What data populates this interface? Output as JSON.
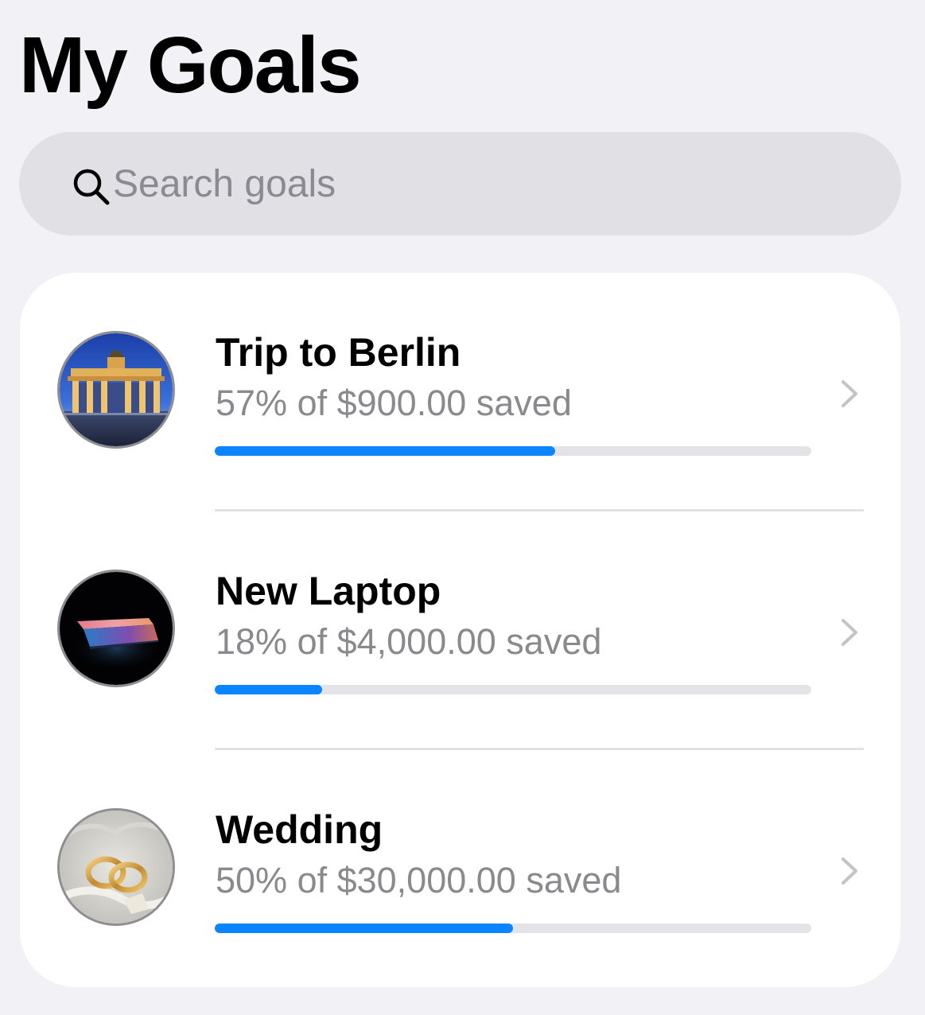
{
  "header": {
    "title": "My Goals"
  },
  "search": {
    "placeholder": "Search goals",
    "value": ""
  },
  "colors": {
    "accent": "#0a84ff",
    "background": "#f1f1f6",
    "card": "#ffffff",
    "track": "#e4e4e8",
    "secondary_text": "#8a8a8e"
  },
  "goals": [
    {
      "name": "Trip to Berlin",
      "progress_text": "57% of $900.00 saved",
      "progress": 0.57,
      "image": "brandenburg-gate-photo"
    },
    {
      "name": "New Laptop",
      "progress_text": "18% of $4,000.00 saved",
      "progress": 0.18,
      "image": "laptop-photo"
    },
    {
      "name": "Wedding",
      "progress_text": "50% of $30,000.00 saved",
      "progress": 0.5,
      "image": "wedding-rings-photo"
    }
  ]
}
